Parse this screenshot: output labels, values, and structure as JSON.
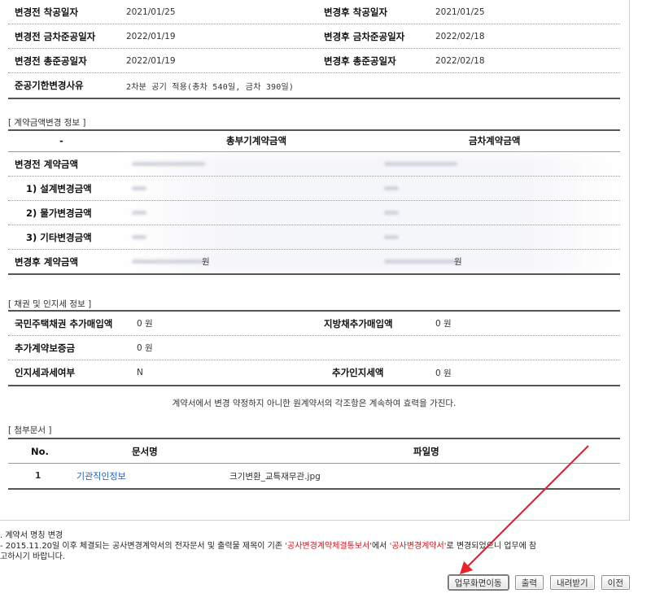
{
  "period": {
    "rows": [
      {
        "l1": "변경전 착공일자",
        "v1": "2021/01/25",
        "l2": "변경후 착공일자",
        "v2": "2021/01/25"
      },
      {
        "l1": "변경전 금차준공일자",
        "v1": "2022/01/19",
        "l2": "변경후 금차준공일자",
        "v2": "2022/02/18"
      },
      {
        "l1": "변경전 총준공일자",
        "v1": "2022/01/19",
        "l2": "변경후 총준공일자",
        "v2": "2022/02/18"
      }
    ],
    "reason_label": "준공기한변경사유",
    "reason_value": "2차분 공기 적용(총차 540일, 금차 390일)"
  },
  "amount": {
    "section_title": "[ 계약금액변경 정보 ]",
    "headers": [
      "-",
      "총부기계약금액",
      "금차계약금액"
    ],
    "rows": [
      {
        "label": "변경전 계약금액"
      },
      {
        "label": "1) 설계변경금액"
      },
      {
        "label": "2) 물가변경금액"
      },
      {
        "label": "3) 기타변경금액"
      },
      {
        "label": "변경후 계약금액"
      }
    ],
    "after_unit_1": "원",
    "after_unit_2": "원"
  },
  "bond": {
    "section_title": "[ 채권 및 인지세 정보 ]",
    "rows": [
      {
        "l1": "국민주택채권 추가매입액",
        "v1": "0 원",
        "l2": "지방채추가매입액",
        "v2": "0 원"
      },
      {
        "l1": "추가계약보증금",
        "v1": "0 원",
        "l2": "",
        "v2": ""
      },
      {
        "l1": "인지세과세여부",
        "v1": "N",
        "l2": "추가인지세액",
        "v2": "0 원"
      }
    ]
  },
  "notice": "계약서에서 변경 약정하지 아니한 원계약서의 각조항은 계속하여 효력을 가진다.",
  "attach": {
    "section_title": "[ 첨부문서 ]",
    "headers": {
      "no": "No.",
      "doc": "문서명",
      "file": "파일명"
    },
    "rows": [
      {
        "no": "1",
        "doc": "기관직인정보",
        "file": "크기변환_교특재무관.jpg"
      }
    ]
  },
  "footnote": {
    "line1": ". 계약서 명칭 변경",
    "line2_a": " - 2015.11.20일 이후 체결되는 공사변경계약서의 전자문서 및 출력물 제목이 기존 ",
    "line2_red1": "'공사변경계약체결통보서'",
    "line2_b": "에서 ",
    "line2_red2": "'공사변경계약서'",
    "line2_c": "로 변경되었으니 업무에 참",
    "line3": "고하시기 바랍니다."
  },
  "buttons": {
    "move": "업무화면이동",
    "print": "출력",
    "download": "내려받기",
    "prev": "이전"
  },
  "colors": {
    "arrow": "#e8232a",
    "link": "#1f5fbf",
    "emphasis": "#d2141a"
  }
}
